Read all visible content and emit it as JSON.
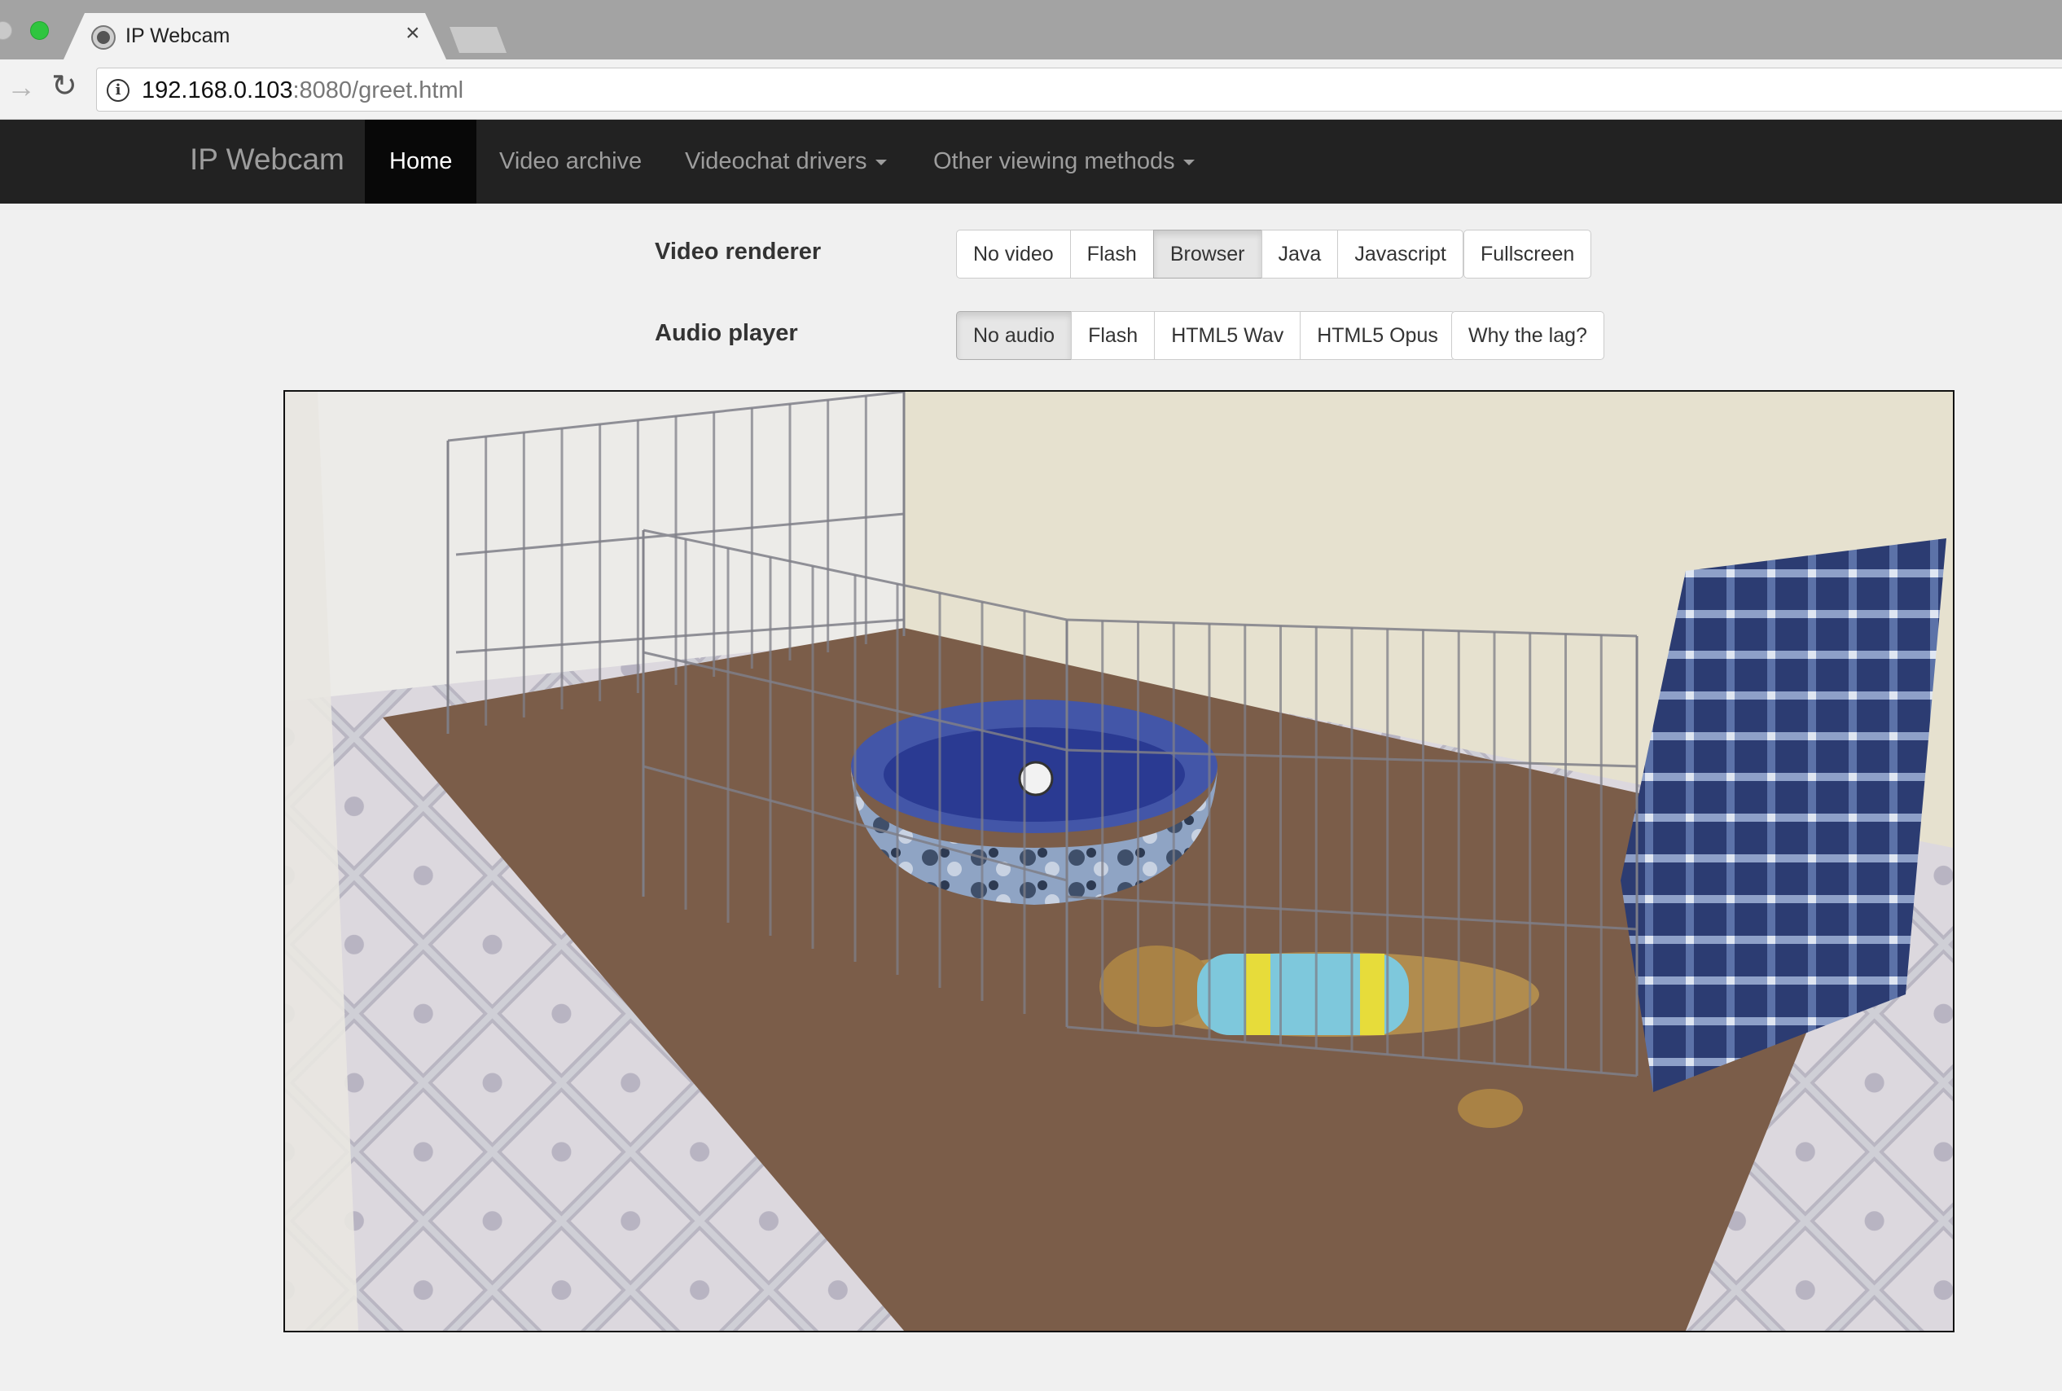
{
  "browser": {
    "tab_title": "IP Webcam",
    "tab_close": "×",
    "url_host": "192.168.0.103",
    "url_rest": ":8080/greet.html"
  },
  "navbar": {
    "brand": "IP Webcam",
    "items": [
      {
        "label": "Home",
        "active": true
      },
      {
        "label": "Video archive"
      },
      {
        "label": "Videochat drivers",
        "dropdown": true
      },
      {
        "label": "Other viewing methods",
        "dropdown": true
      }
    ]
  },
  "video_renderer": {
    "label": "Video renderer",
    "options": [
      "No video",
      "Flash",
      "Browser",
      "Java",
      "Javascript"
    ],
    "selected": "Browser",
    "fullscreen": "Fullscreen"
  },
  "audio_player": {
    "label": "Audio player",
    "options": [
      "No audio",
      "Flash",
      "HTML5 Wav",
      "HTML5 Opus"
    ],
    "selected": "No audio",
    "help": "Why the lag?"
  },
  "video_feed": {
    "description": "Live camera stream"
  }
}
